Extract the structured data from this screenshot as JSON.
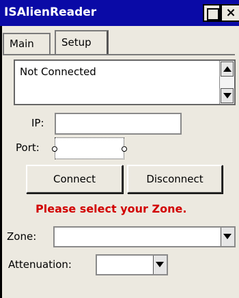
{
  "window": {
    "title": "ISAlienReader",
    "close_glyph": "×"
  },
  "tabs": [
    {
      "label": "Main"
    },
    {
      "label": "Setup"
    }
  ],
  "status": {
    "text": "Not Connected"
  },
  "form": {
    "ip_label": "IP:",
    "ip_value": "",
    "port_label": "Port:",
    "port_value": "",
    "connect_label": "Connect",
    "disconnect_label": "Disconnect",
    "warning": "Please select your Zone.",
    "zone_label": "Zone:",
    "zone_value": "",
    "attenuation_label": "Attenuation:",
    "attenuation_value": ""
  },
  "colors": {
    "titlebar": "#0a0aa6",
    "warning": "#d10000",
    "panel": "#ece9e0"
  }
}
